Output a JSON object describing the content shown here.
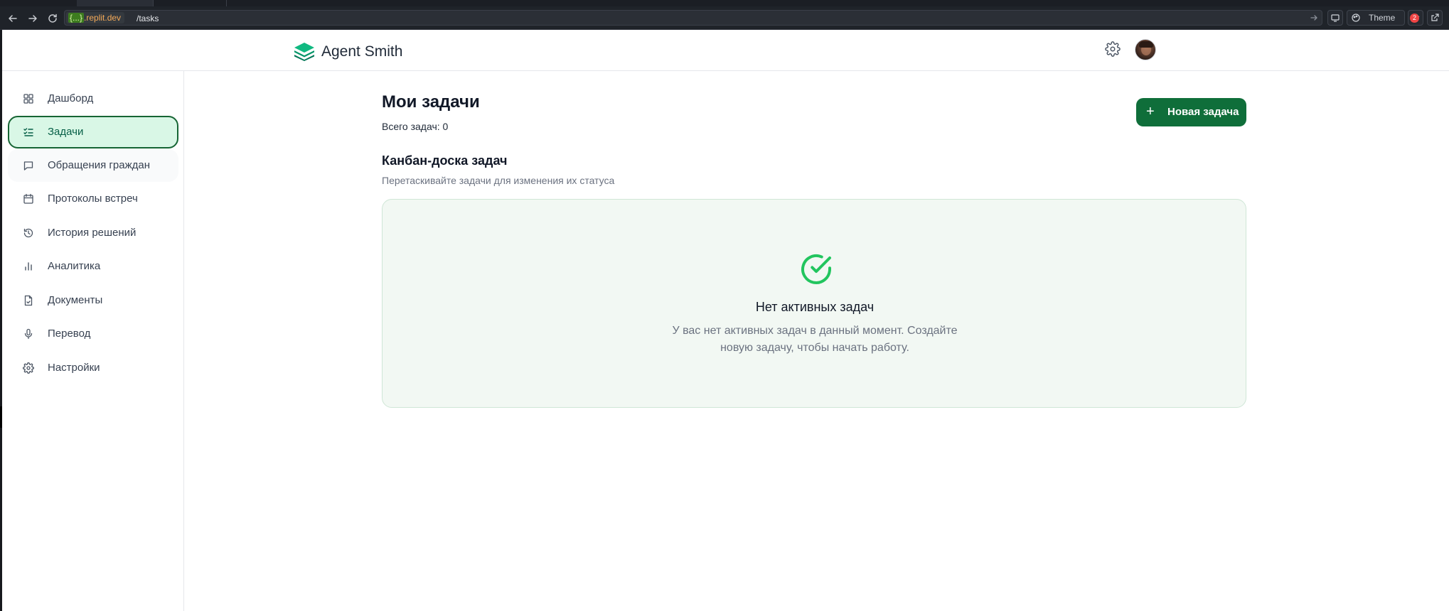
{
  "browser": {
    "url_host_placeholder": "{...}",
    "url_host": ".replit.dev",
    "url_path": "/tasks",
    "theme_label": "Theme",
    "notification_count": "2"
  },
  "header": {
    "app_name": "Agent Smith"
  },
  "sidebar": {
    "items": [
      {
        "label": "Дашборд",
        "icon": "dashboard-grid-icon"
      },
      {
        "label": "Задачи",
        "icon": "task-list-icon",
        "active": true
      },
      {
        "label": "Обращения граждан",
        "icon": "message-square-icon"
      },
      {
        "label": "Протоколы встреч",
        "icon": "calendar-icon"
      },
      {
        "label": "История решений",
        "icon": "history-icon"
      },
      {
        "label": "Аналитика",
        "icon": "bar-chart-icon"
      },
      {
        "label": "Документы",
        "icon": "document-icon"
      },
      {
        "label": "Перевод",
        "icon": "microphone-icon"
      },
      {
        "label": "Настройки",
        "icon": "gear-icon"
      }
    ]
  },
  "main": {
    "title": "Мои задачи",
    "task_count": "Всего задач: 0",
    "new_task_button": "Новая задача",
    "board_title": "Канбан-доска задач",
    "board_subtitle": "Перетаскивайте задачи для изменения их статуса",
    "empty_state": {
      "title": "Нет активных задач",
      "text_line1": "У вас нет активных задач в данный момент. Создайте",
      "text_line2": "новую задачу, чтобы начать работу."
    }
  },
  "colors": {
    "brand_green": "#0f6e3a",
    "active_nav_bg": "#d9f7e6",
    "success_check": "#22c55e"
  }
}
